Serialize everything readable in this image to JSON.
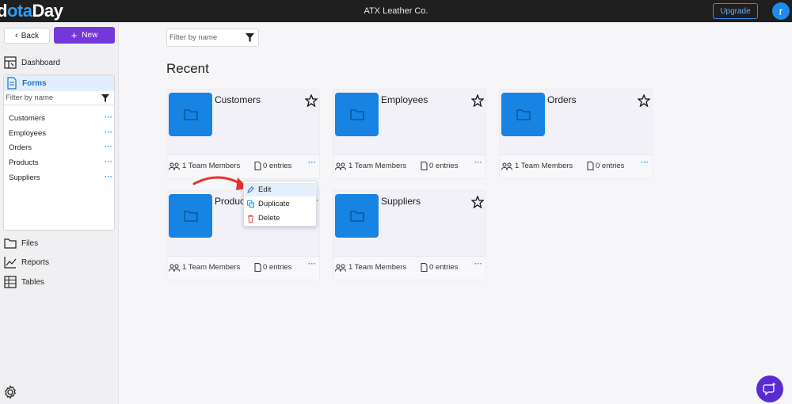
{
  "app": {
    "logo_part1": "d",
    "logo_part2": "ta",
    "logo_part3": "Day",
    "title": "ATX Leather Co.",
    "upgrade_label": "Upgrade",
    "avatar_initial": "r"
  },
  "sidebar": {
    "back_label": "Back",
    "new_label": "New",
    "dashboard_label": "Dashboard",
    "forms_label": "Forms",
    "filter_placeholder": "Filter by name",
    "forms": [
      "Customers",
      "Employees",
      "Orders",
      "Products",
      "Suppliers"
    ],
    "files_label": "Files",
    "reports_label": "Reports",
    "tables_label": "Tables"
  },
  "main": {
    "filter_placeholder": "Filter by name",
    "recent_title": "Recent",
    "cards": [
      {
        "name": "Customers",
        "members": "1 Team Members",
        "entries": "0 entries"
      },
      {
        "name": "Employees",
        "members": "1 Team Members",
        "entries": "0 entries"
      },
      {
        "name": "Orders",
        "members": "1 Team Members",
        "entries": "0 entries"
      },
      {
        "name": "Products",
        "members": "1 Team Members",
        "entries": "0 entries"
      },
      {
        "name": "Suppliers",
        "members": "1 Team Members",
        "entries": "0 entries"
      }
    ]
  },
  "context_menu": {
    "edit_label": "Edit",
    "duplicate_label": "Duplicate",
    "delete_label": "Delete"
  },
  "colors": {
    "accent_purple": "#7238d9",
    "folder_blue": "#1783e3",
    "link_blue": "#1ea0ef",
    "arrow_red": "#e8322e"
  }
}
